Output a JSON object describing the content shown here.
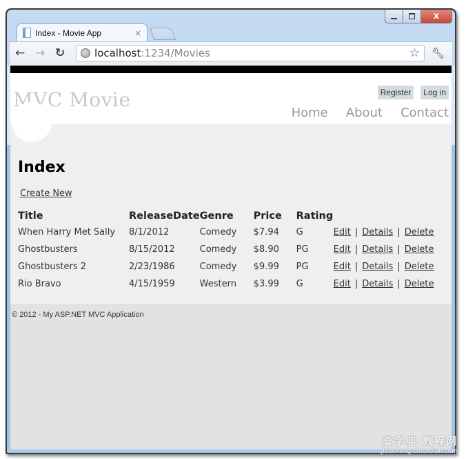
{
  "browser": {
    "tab_title": "Index - Movie App",
    "tab_close": "×",
    "url_host": "localhost",
    "url_rest": ":1234/Movies",
    "window_close": "x"
  },
  "site": {
    "title": "MVC Movie",
    "login_links": [
      "Register",
      "Log in"
    ],
    "menu": [
      "Home",
      "About",
      "Contact"
    ]
  },
  "page": {
    "heading": "Index",
    "create_link": "Create New",
    "columns": [
      "Title",
      "ReleaseDate",
      "Genre",
      "Price",
      "Rating"
    ],
    "rows": [
      {
        "title": "When Harry Met Sally",
        "release": "8/1/2012",
        "genre": "Comedy",
        "price": "$7.94",
        "rating": "G"
      },
      {
        "title": "Ghostbusters",
        "release": "8/15/2012",
        "genre": "Comedy",
        "price": "$8.90",
        "rating": "PG"
      },
      {
        "title": "Ghostbusters 2",
        "release": "2/23/1986",
        "genre": "Comedy",
        "price": "$9.99",
        "rating": "PG"
      },
      {
        "title": "Rio Bravo",
        "release": "4/15/1959",
        "genre": "Western",
        "price": "$3.99",
        "rating": "G"
      }
    ],
    "actions": [
      "Edit",
      "Details",
      "Delete"
    ],
    "separator": "|"
  },
  "footer": {
    "text": "© 2012 - My ASP.NET MVC Application"
  },
  "watermark": {
    "line1": "查字典 教程网",
    "line2": "jiaocheng.chazidian.com"
  }
}
